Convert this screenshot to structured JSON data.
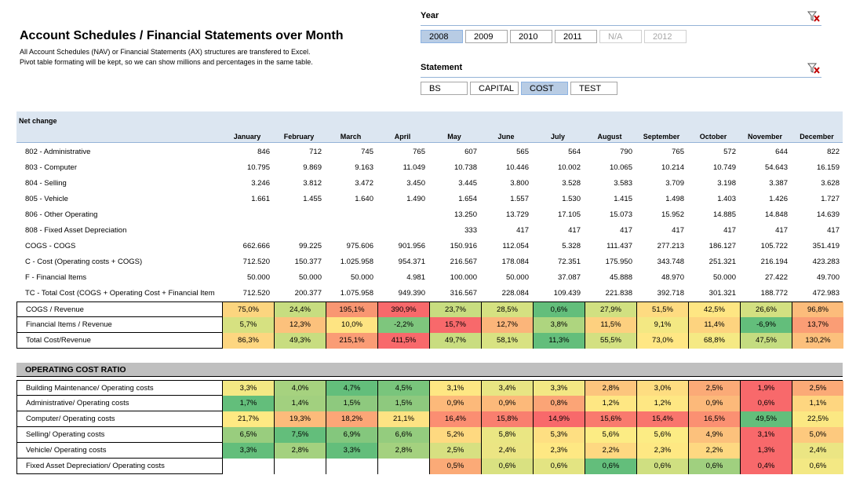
{
  "title": "Account Schedules / Financial Statements over Month",
  "description": [
    "All Account Schedules (NAV) or Financial Statements (AX) structures are transfered to Excel.",
    "Pivot table formating  will be kept, so we can show millions and percentages in the same table."
  ],
  "year_filter": {
    "label": "Year",
    "clear_icon": "clear-filter-icon",
    "items": [
      {
        "label": "2008",
        "state": "selected"
      },
      {
        "label": "2009",
        "state": "normal"
      },
      {
        "label": "2010",
        "state": "normal"
      },
      {
        "label": "2011",
        "state": "normal"
      },
      {
        "label": "N/A",
        "state": "disabled"
      },
      {
        "label": "2012",
        "state": "disabled"
      }
    ]
  },
  "statement_filter": {
    "label": "Statement",
    "clear_icon": "clear-filter-icon",
    "items": [
      {
        "label": "BS",
        "state": "normal"
      },
      {
        "label": "CAPITAL",
        "state": "normal"
      },
      {
        "label": "COST",
        "state": "selected"
      },
      {
        "label": "TEST",
        "state": "normal"
      }
    ]
  },
  "pivot": {
    "header": "Net change",
    "months": [
      "January",
      "February",
      "March",
      "April",
      "May",
      "June",
      "July",
      "August",
      "September",
      "October",
      "November",
      "December"
    ],
    "rows": [
      {
        "label": "802 - Administrative",
        "values": [
          "846",
          "712",
          "745",
          "765",
          "607",
          "565",
          "564",
          "790",
          "765",
          "572",
          "644",
          "822"
        ]
      },
      {
        "label": "803 - Computer",
        "values": [
          "10.795",
          "9.869",
          "9.163",
          "11.049",
          "10.738",
          "10.446",
          "10.002",
          "10.065",
          "10.214",
          "10.749",
          "54.643",
          "16.159"
        ]
      },
      {
        "label": "804 - Selling",
        "values": [
          "3.246",
          "3.812",
          "3.472",
          "3.450",
          "3.445",
          "3.800",
          "3.528",
          "3.583",
          "3.709",
          "3.198",
          "3.387",
          "3.628"
        ]
      },
      {
        "label": "805 - Vehicle",
        "values": [
          "1.661",
          "1.455",
          "1.640",
          "1.490",
          "1.654",
          "1.557",
          "1.530",
          "1.415",
          "1.498",
          "1.403",
          "1.426",
          "1.727"
        ]
      },
      {
        "label": "806 - Other Operating",
        "values": [
          "",
          "",
          "",
          "",
          "13.250",
          "13.729",
          "17.105",
          "15.073",
          "15.952",
          "14.885",
          "14.848",
          "14.639"
        ]
      },
      {
        "label": "808 - Fixed Asset Depreciation",
        "values": [
          "",
          "",
          "",
          "",
          "333",
          "417",
          "417",
          "417",
          "417",
          "417",
          "417",
          "417"
        ]
      },
      {
        "label": "COGS - COGS",
        "values": [
          "662.666",
          "99.225",
          "975.606",
          "901.956",
          "150.916",
          "112.054",
          "5.328",
          "111.437",
          "277.213",
          "186.127",
          "105.722",
          "351.419"
        ]
      },
      {
        "label": "C - Cost (Operating costs + COGS)",
        "values": [
          "712.520",
          "150.377",
          "1.025.958",
          "954.371",
          "216.567",
          "178.084",
          "72.351",
          "175.950",
          "343.748",
          "251.321",
          "216.194",
          "423.283"
        ]
      },
      {
        "label": "F - Financial Items",
        "values": [
          "50.000",
          "50.000",
          "50.000",
          "4.981",
          "100.000",
          "50.000",
          "37.087",
          "45.888",
          "48.970",
          "50.000",
          "27.422",
          "49.700"
        ]
      },
      {
        "label": "TC - Total Cost (COGS + Operating Cost + Financial Item",
        "values": [
          "712.520",
          "200.377",
          "1.075.958",
          "949.390",
          "316.567",
          "228.084",
          "109.439",
          "221.838",
          "392.718",
          "301.321",
          "188.772",
          "472.983"
        ]
      }
    ],
    "ratios": [
      {
        "label": "COGS / Revenue",
        "values": [
          "75,0%",
          "24,4%",
          "195,1%",
          "390,9%",
          "23,7%",
          "28,5%",
          "0,6%",
          "27,9%",
          "51,5%",
          "42,5%",
          "26,6%",
          "96,8%"
        ],
        "colors": [
          "#fcd57f",
          "#c7dd80",
          "#f99672",
          "#f8696b",
          "#c8dd80",
          "#d5e181",
          "#63be7b",
          "#d1e081",
          "#fedb81",
          "#fee683",
          "#d3e081",
          "#fcbc7b"
        ]
      },
      {
        "label": "Financial Items / Revenue",
        "values": [
          "5,7%",
          "12,3%",
          "10,0%",
          "-2,2%",
          "15,7%",
          "12,7%",
          "3,8%",
          "11,5%",
          "9,1%",
          "11,4%",
          "-6,9%",
          "13,7%"
        ],
        "colors": [
          "#d6e181",
          "#fcc17c",
          "#fee482",
          "#7ec67d",
          "#f8696b",
          "#fbb57a",
          "#aed57f",
          "#fdd07f",
          "#f3e883",
          "#fdd37f",
          "#63be7b",
          "#fa9d75"
        ]
      },
      {
        "label": "Total Cost/Revenue",
        "values": [
          "86,3%",
          "49,3%",
          "215,1%",
          "411,5%",
          "49,7%",
          "58,1%",
          "11,3%",
          "55,5%",
          "73,0%",
          "68,8%",
          "47,5%",
          "130,2%"
        ],
        "colors": [
          "#fdd680",
          "#c8dd80",
          "#fa9c75",
          "#f8696b",
          "#c9dd80",
          "#d8e282",
          "#63be7b",
          "#d3e081",
          "#ffe784",
          "#f5e984",
          "#c4dc80",
          "#fcc07c"
        ]
      }
    ]
  },
  "operating_cost_ratio": {
    "header": "OPERATING COST RATIO",
    "rows": [
      {
        "label": "Building Maintenance/ Operating costs",
        "values": [
          "3,3%",
          "4,0%",
          "4,7%",
          "4,5%",
          "3,1%",
          "3,4%",
          "3,3%",
          "2,8%",
          "3,0%",
          "2,5%",
          "1,9%",
          "2,5%"
        ],
        "colors": [
          "#f3e884",
          "#a6d27f",
          "#63be7b",
          "#79c57c",
          "#fee783",
          "#e8e583",
          "#f3e884",
          "#fcc57d",
          "#fedd81",
          "#fbaa77",
          "#f8696b",
          "#fbaa77"
        ]
      },
      {
        "label": "Administrative/ Operating costs",
        "values": [
          "1,7%",
          "1,4%",
          "1,5%",
          "1,5%",
          "0,9%",
          "0,9%",
          "0,8%",
          "1,2%",
          "1,2%",
          "0,9%",
          "0,6%",
          "1,1%"
        ],
        "colors": [
          "#63be7b",
          "#a2d07f",
          "#8ec97e",
          "#8ec97e",
          "#fcb97a",
          "#fcb97a",
          "#fba476",
          "#fee783",
          "#fee783",
          "#fcb97a",
          "#f8696b",
          "#fed680"
        ]
      },
      {
        "label": "Computer/ Operating costs",
        "values": [
          "21,7%",
          "19,3%",
          "18,2%",
          "21,1%",
          "16,4%",
          "15,8%",
          "14,9%",
          "15,6%",
          "15,4%",
          "16,5%",
          "49,5%",
          "22,5%"
        ],
        "colors": [
          "#fee983",
          "#fcbb7b",
          "#fca677",
          "#fde383",
          "#fb8e72",
          "#f97f6f",
          "#f8696b",
          "#f97a6e",
          "#f9756d",
          "#fb9072",
          "#63be7b",
          "#fbe883"
        ]
      },
      {
        "label": "Selling/ Operating costs",
        "values": [
          "6,5%",
          "7,5%",
          "6,9%",
          "6,6%",
          "5,2%",
          "5,8%",
          "5,3%",
          "5,6%",
          "5,6%",
          "4,9%",
          "3,1%",
          "5,0%"
        ],
        "colors": [
          "#99cd7e",
          "#63be7b",
          "#84c77d",
          "#94cc7e",
          "#fed980",
          "#eae683",
          "#fedf82",
          "#fcec84",
          "#fcec84",
          "#fcc17c",
          "#f8696b",
          "#fdc97e"
        ]
      },
      {
        "label": "Vehicle/ Operating costs",
        "values": [
          "3,3%",
          "2,8%",
          "3,3%",
          "2,8%",
          "2,5%",
          "2,4%",
          "2,3%",
          "2,2%",
          "2,3%",
          "2,2%",
          "1,3%",
          "2,4%"
        ],
        "colors": [
          "#63be7b",
          "#a4d17f",
          "#63be7b",
          "#a4d17f",
          "#d7e081",
          "#ebe583",
          "#fee883",
          "#fed881",
          "#fee883",
          "#fed881",
          "#f8696b",
          "#ebe583"
        ]
      },
      {
        "label": "Fixed Asset Depreciation/ Operating costs",
        "values": [
          "",
          "",
          "",
          "",
          "0,5%",
          "0,6%",
          "0,6%",
          "0,6%",
          "0,6%",
          "0,6%",
          "0,4%",
          "0,6%"
        ],
        "colors": [
          "#ffffff",
          "#ffffff",
          "#ffffff",
          "#ffffff",
          "#fbaa77",
          "#d9e181",
          "#e3e482",
          "#63be7b",
          "#cfdf81",
          "#a0d07f",
          "#f8696b",
          "#f3e884"
        ]
      }
    ]
  }
}
